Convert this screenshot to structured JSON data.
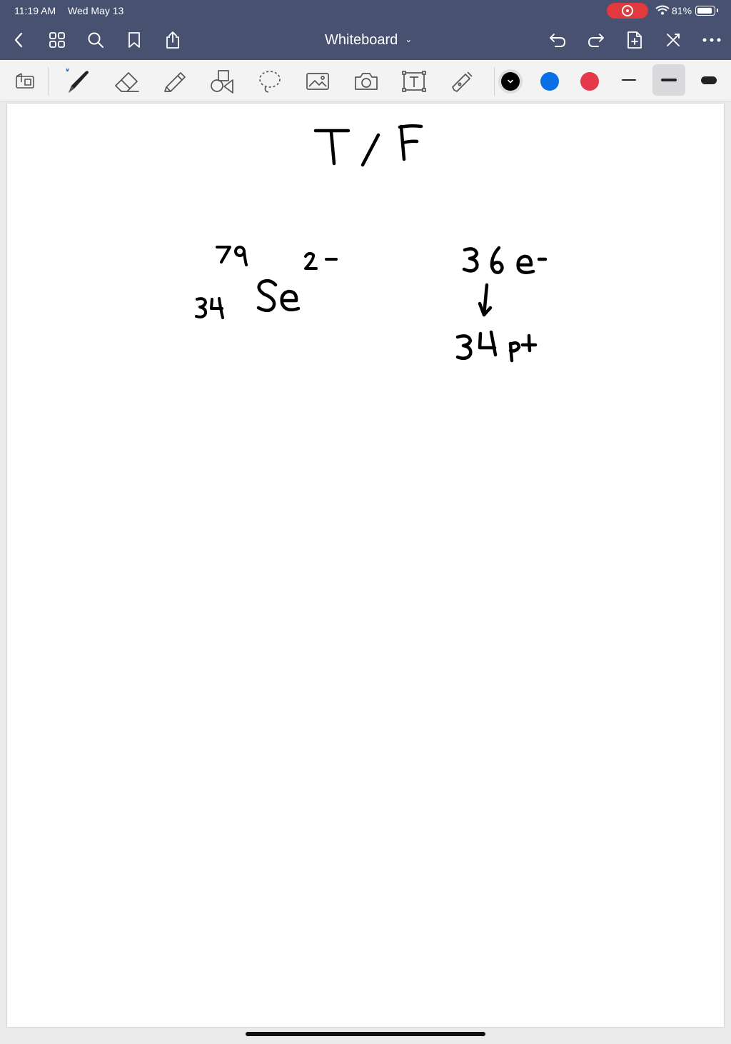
{
  "status_bar": {
    "time": "11:19 AM",
    "date": "Wed May 13",
    "battery": "81%",
    "battery_level": 0.81,
    "recording_color": "#e0393e"
  },
  "nav_bar": {
    "title": "Whiteboard",
    "icons": [
      "back-icon",
      "thumbnails-icon",
      "search-icon",
      "bookmark-icon",
      "share-icon",
      "undo-icon",
      "redo-icon",
      "add-page-icon",
      "close-toolbar-icon",
      "more-icon"
    ]
  },
  "toolbar": {
    "tools": [
      "zoom-window",
      "pen",
      "eraser",
      "highlighter",
      "shapes",
      "lasso",
      "image",
      "camera",
      "text",
      "laser-pointer"
    ],
    "colors": [
      "#000000",
      "#0a6fe6",
      "#e5384a"
    ],
    "selected_color": "#000000",
    "stroke_widths": [
      "thin",
      "medium",
      "thick"
    ],
    "selected_stroke": "medium"
  },
  "canvas": {
    "heading": "T/F",
    "mass_number": "79",
    "charge": "2-",
    "atomic_number": "34",
    "element_symbol": "Se",
    "electrons": "36 e-",
    "protons": "34 p+"
  }
}
